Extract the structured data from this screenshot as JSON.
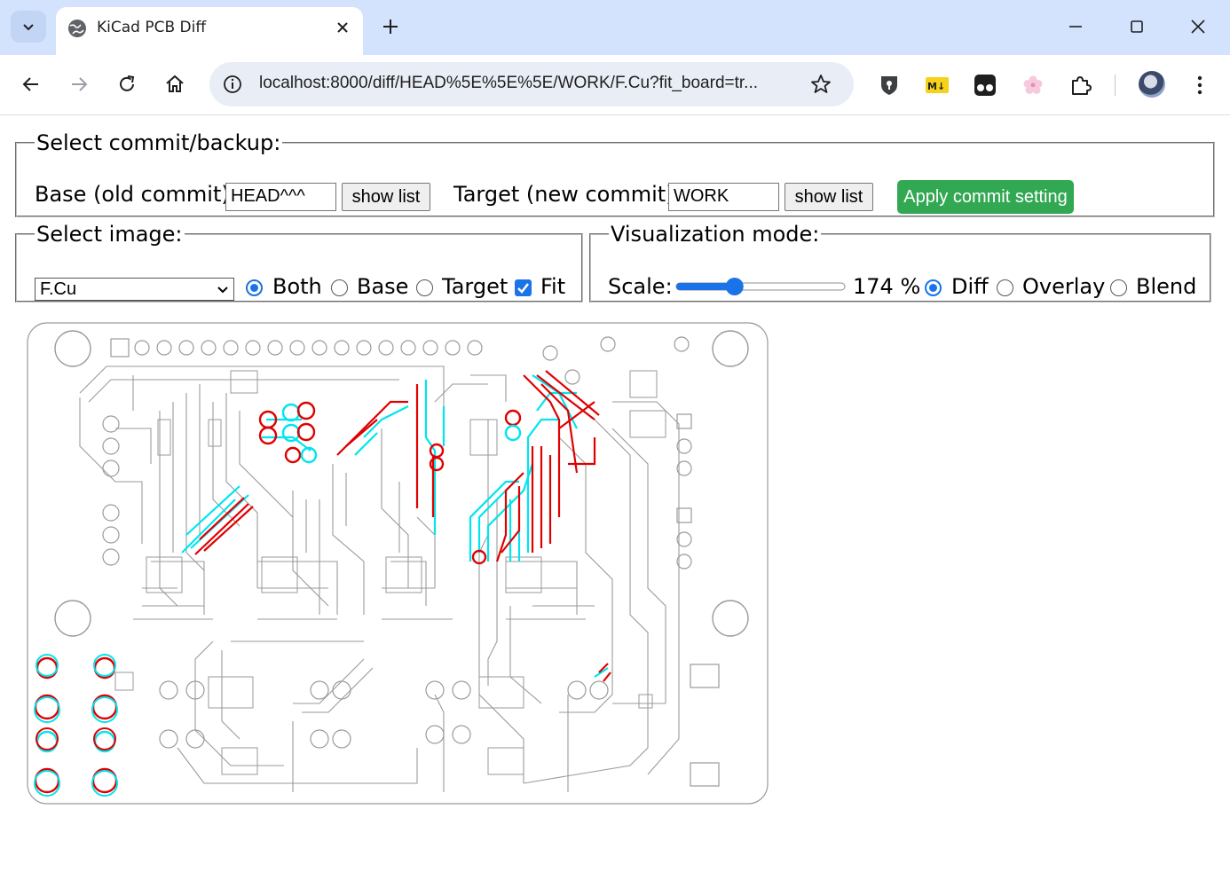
{
  "browser": {
    "tab_title": "KiCad PCB Diff",
    "url": "localhost:8000/diff/HEAD%5E%5E%5E/WORK/F.Cu?fit_board=tr..."
  },
  "commit": {
    "legend": "Select commit/backup:",
    "base_label": "Base (old commit):",
    "base_value": "HEAD^^^",
    "base_show_list": "show list",
    "target_label": "Target (new commit):",
    "target_value": "WORK",
    "target_show_list": "show list",
    "apply": "Apply commit setting"
  },
  "image": {
    "legend": "Select image:",
    "layer_selected": "F.Cu",
    "options": [
      {
        "label": "Both",
        "checked": true
      },
      {
        "label": "Base",
        "checked": false
      },
      {
        "label": "Target",
        "checked": false
      }
    ],
    "fit_label": "Fit",
    "fit_checked": true
  },
  "viz": {
    "legend": "Visualization mode:",
    "scale_label": "Scale:",
    "scale_value": "174 %",
    "scale_fraction": 0.33,
    "modes": [
      {
        "label": "Diff",
        "checked": true
      },
      {
        "label": "Overlay",
        "checked": false
      },
      {
        "label": "Blend",
        "checked": false
      }
    ]
  },
  "colors": {
    "accent": "#1a73e8",
    "apply_green": "#33a853",
    "diff_red": "#e00000",
    "diff_cyan": "#00e5ee",
    "trace_gray": "#9a9a9a"
  }
}
